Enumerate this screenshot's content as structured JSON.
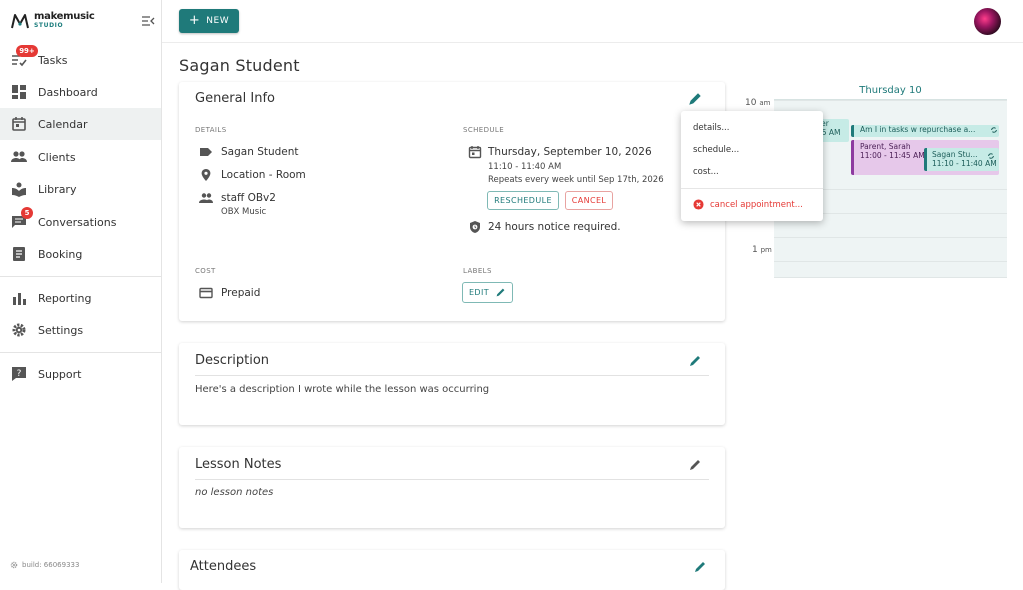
{
  "app": {
    "logo_text": "makemusic",
    "logo_sub": "STUDIO"
  },
  "sidebar": {
    "items": [
      {
        "label": "Tasks",
        "badge": "99+"
      },
      {
        "label": "Dashboard"
      },
      {
        "label": "Calendar"
      },
      {
        "label": "Clients"
      },
      {
        "label": "Library"
      },
      {
        "label": "Conversations",
        "badge": "5"
      },
      {
        "label": "Booking"
      },
      {
        "label": "Reporting"
      },
      {
        "label": "Settings"
      },
      {
        "label": "Support"
      }
    ],
    "build": "build: 66069333"
  },
  "toolbar": {
    "new_label": "NEW"
  },
  "page": {
    "title": "Sagan Student"
  },
  "general": {
    "title": "General Info",
    "details_label": "DETAILS",
    "student": "Sagan Student",
    "location": "Location - Room",
    "staff": "staff OBv2",
    "org": "OBX Music",
    "schedule_label": "SCHEDULE",
    "date": "Thursday, September 10, 2026",
    "time": "11:10 - 11:40 AM",
    "repeat": "Repeats every week until Sep 17th, 2026",
    "reschedule": "RESCHEDULE",
    "cancel": "CANCEL",
    "notice": "24 hours notice required.",
    "cost_label": "COST",
    "cost": "Prepaid",
    "labels_label": "LABELS",
    "labels_edit": "EDIT"
  },
  "description": {
    "title": "Description",
    "text": "Here's a description I wrote while the lesson was occurring"
  },
  "notes": {
    "title": "Lesson Notes",
    "text": "no lesson notes"
  },
  "attendees": {
    "title": "Attendees"
  },
  "calendar": {
    "day_header": "Thursday 10",
    "hours": [
      {
        "h": "10",
        "ampm": "am"
      },
      {
        "h": "1",
        "ampm": "pm"
      }
    ],
    "events": [
      {
        "line1": "cer",
        "line2": "15 AM"
      },
      {
        "line1": "Am I in tasks w repurchase a..."
      },
      {
        "line1": "Parent, Sarah",
        "line2": "11:00 - 11:45 AM"
      },
      {
        "line1": "Sagan Stu...",
        "line2": "11:10 - 11:40 AM"
      }
    ]
  },
  "menu": {
    "items": [
      "details...",
      "schedule...",
      "cost..."
    ],
    "danger": "cancel appointment..."
  },
  "colors": {
    "accent": "#1f7a7a",
    "danger": "#e53935",
    "event_teal": "#c6ebe6",
    "event_purple": "#e6c8ea"
  }
}
